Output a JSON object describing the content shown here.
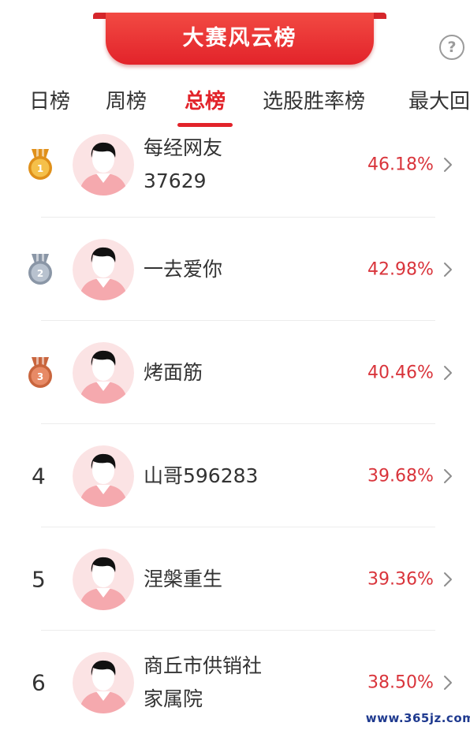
{
  "header": {
    "title": "大赛风云榜",
    "help_glyph": "?"
  },
  "tabs": [
    {
      "label": "日榜",
      "active": false
    },
    {
      "label": "周榜",
      "active": false
    },
    {
      "label": "总榜",
      "active": true
    },
    {
      "label": "选股胜率榜",
      "active": false
    },
    {
      "label": "最大回",
      "active": false
    }
  ],
  "ranking": [
    {
      "rank": "1",
      "medal": "gold-medal-icon",
      "name_lines": [
        "每经网友",
        "37629"
      ],
      "rate": "46.18%"
    },
    {
      "rank": "2",
      "medal": "silver-medal-icon",
      "name_lines": [
        "一去爱你"
      ],
      "rate": "42.98%"
    },
    {
      "rank": "3",
      "medal": "bronze-medal-icon",
      "name_lines": [
        "烤面筋"
      ],
      "rate": "40.46%"
    },
    {
      "rank": "4",
      "medal": null,
      "name_lines": [
        "山哥596283"
      ],
      "rate": "39.68%"
    },
    {
      "rank": "5",
      "medal": null,
      "name_lines": [
        "涅槃重生"
      ],
      "rate": "39.36%"
    },
    {
      "rank": "6",
      "medal": null,
      "name_lines": [
        "商丘市供销社",
        "家属院"
      ],
      "rate": "38.50%"
    }
  ],
  "watermark": "www.365jz.com",
  "colors": {
    "accent": "#e2232a",
    "rate": "#d9343b",
    "gold": "#e8a21e",
    "silver": "#8a96a6",
    "bronze": "#c9653d"
  }
}
